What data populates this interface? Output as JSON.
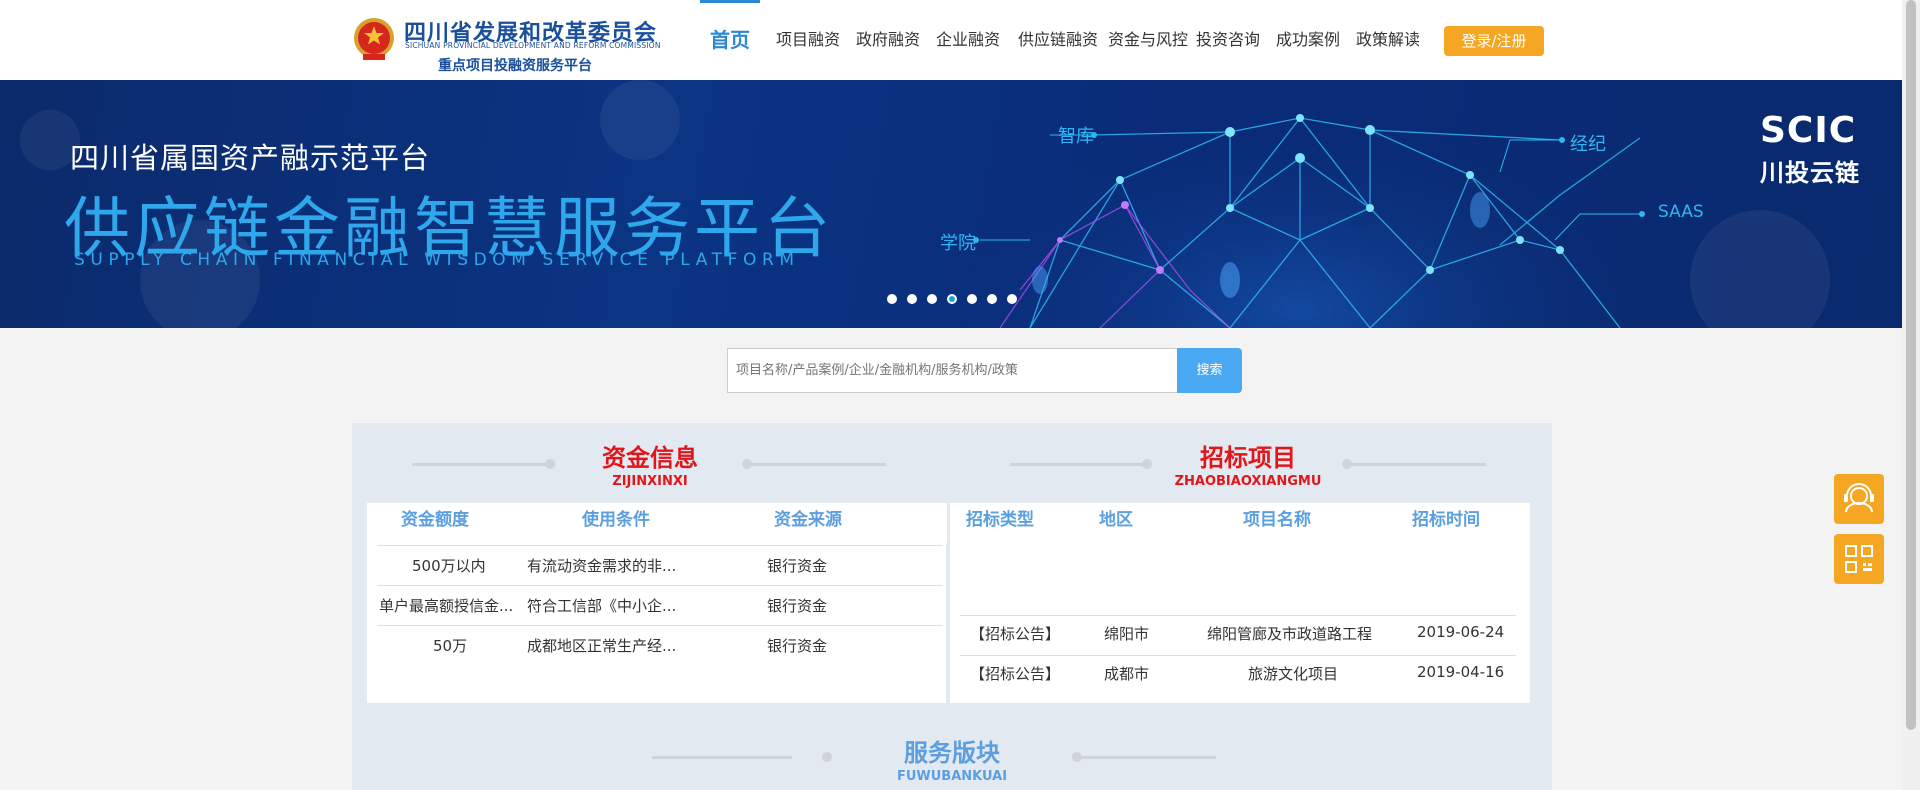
{
  "header": {
    "logo_cn": "四川省发展和改革委员会",
    "logo_en": "SICHUAN PROVINCIAL DEVELOPMENT AND REFORM COMMISSION",
    "logo_sub": "重点项目投融资服务平台",
    "nav": [
      "首页",
      "项目融资",
      "政府融资",
      "企业融资",
      "供应链融资",
      "资金与风控",
      "投资咨询",
      "成功案例",
      "政策解读"
    ],
    "login": "登录/注册"
  },
  "banner": {
    "small": "四川省属国资产融示范平台",
    "big": "供应链金融智慧服务平台",
    "en": "SUPPLY CHAIN FINANCIAL WISDOM SERVICE PLATFORM",
    "brand_en": "SCIC",
    "brand_cn": "川投云链",
    "labels": [
      "智库",
      "经纪",
      "学院",
      "SAAS"
    ],
    "dots_total": 7,
    "dots_active_index": 3
  },
  "search": {
    "placeholder": "项目名称/产品案例/企业/金融机构/服务机构/政策",
    "button": "搜索"
  },
  "funds": {
    "title_cn": "资金信息",
    "title_en": "ZIJINXINXI",
    "headers": [
      "资金额度",
      "使用条件",
      "资金来源"
    ],
    "rows": [
      [
        "500万以内",
        "有流动资金需求的非...",
        "银行资金"
      ],
      [
        "单户最高额授信金...",
        "符合工信部《中小企...",
        "银行资金"
      ],
      [
        "50万",
        "成都地区正常生产经...",
        "银行资金"
      ]
    ]
  },
  "bids": {
    "title_cn": "招标项目",
    "title_en": "ZHAOBIAOXIANGMU",
    "headers": [
      "招标类型",
      "地区",
      "项目名称",
      "招标时间"
    ],
    "rows": [
      [
        "【招标公告】",
        "绵阳市",
        "绵阳管廊及市政道路工程",
        "2019-06-24"
      ],
      [
        "【招标公告】",
        "成都市",
        "旅游文化项目",
        "2019-04-16"
      ]
    ]
  },
  "services": {
    "title_cn": "服务版块",
    "title_en": "FUWUBANKUAI"
  },
  "colors": {
    "primary": "#2c87d5",
    "orange": "#f5a623",
    "red": "#e0161b",
    "banner_bg": "#0b2a6b"
  }
}
